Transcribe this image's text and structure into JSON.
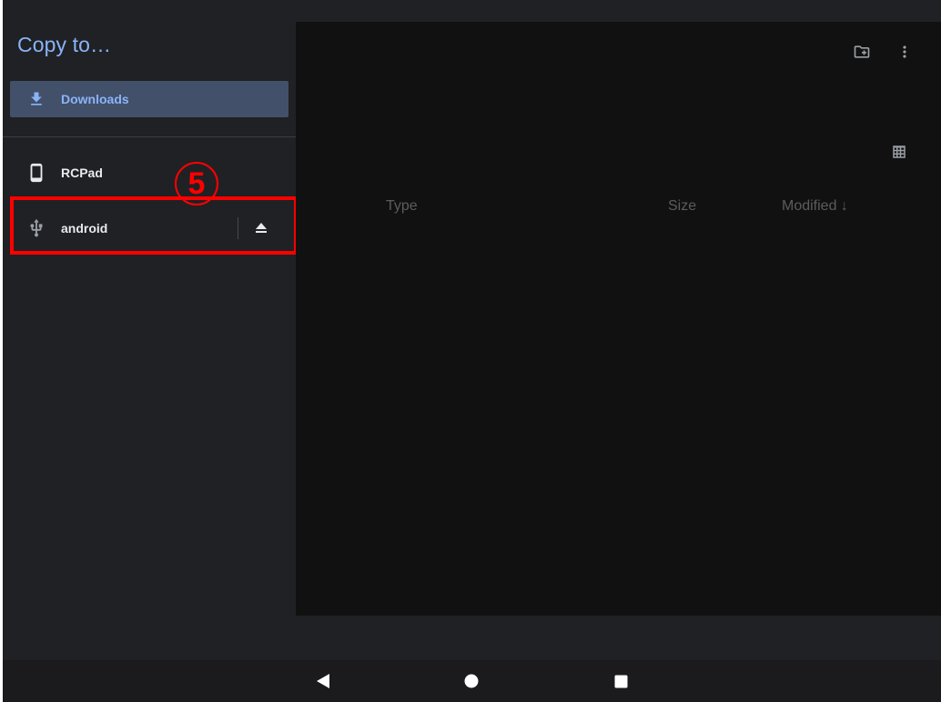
{
  "drawer": {
    "title": "Copy to…",
    "items": [
      {
        "label": "Downloads",
        "icon": "download-icon",
        "selected": true
      },
      {
        "label": "RCPad",
        "icon": "phone-icon",
        "selected": false
      },
      {
        "label": "android",
        "icon": "usb-icon",
        "selected": false,
        "action_icon": "eject-icon"
      }
    ]
  },
  "toolbar": {
    "icons": [
      "new-folder-icon",
      "more-vert-icon",
      "grid-view-icon"
    ]
  },
  "columns": {
    "type": "Type",
    "size": "Size",
    "modified": "Modified ↓"
  },
  "annotation": {
    "number": "5",
    "color": "#ff0000"
  },
  "nav": {
    "icons": [
      "back-icon",
      "home-icon",
      "recents-icon"
    ]
  },
  "colors": {
    "accent": "#8ab4f8",
    "selected_bg": "#43506a",
    "drawer_bg": "#202124",
    "content_bg": "#111111"
  }
}
